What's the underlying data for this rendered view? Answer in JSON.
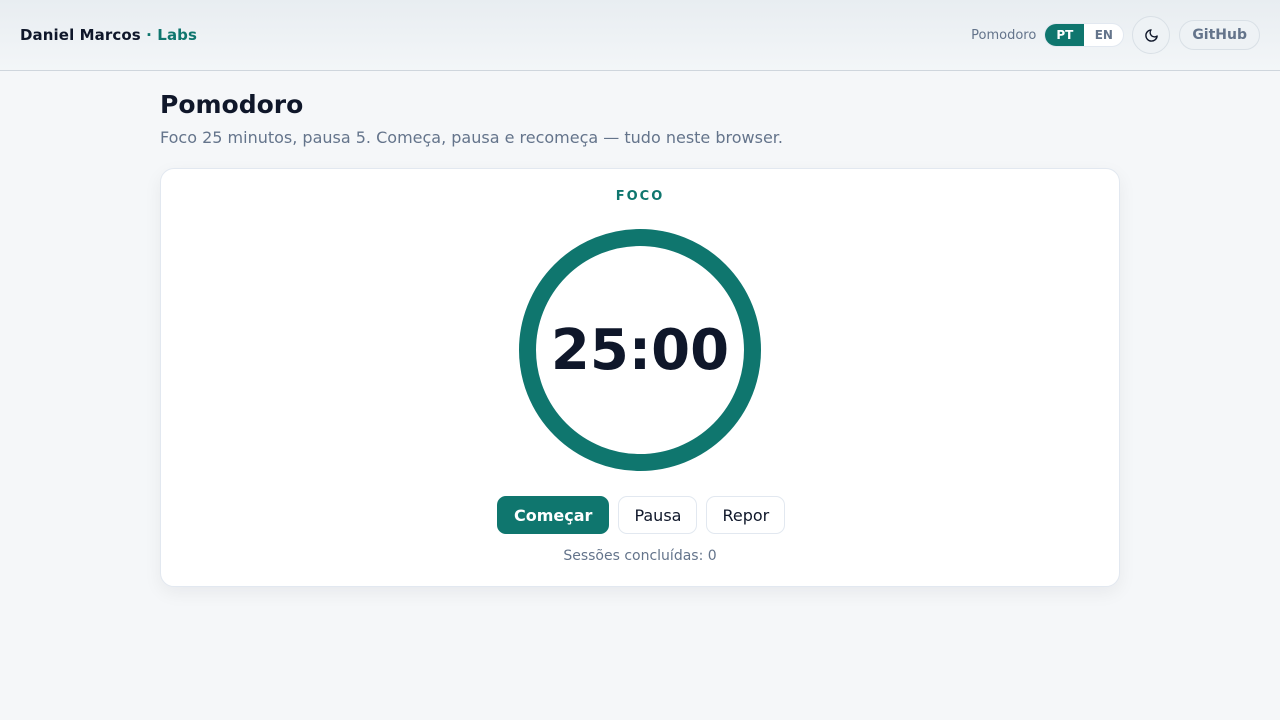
{
  "header": {
    "brand_name": "Daniel Marcos",
    "brand_separator": "·",
    "brand_labs": "Labs",
    "app_name": "Pomodoro",
    "languages": [
      "PT",
      "EN"
    ],
    "active_language": "PT",
    "github_label": "GitHub",
    "theme_icon": "moon-icon"
  },
  "page": {
    "title": "Pomodoro",
    "subtitle": "Foco 25 minutos, pausa 5. Começa, pausa e recomeça — tudo neste browser."
  },
  "timer": {
    "phase": "FOCO",
    "time": "25:00",
    "progress": 1.0,
    "ring_color": "#0f766e"
  },
  "controls": {
    "start_label": "Começar",
    "pause_label": "Pausa",
    "reset_label": "Repor"
  },
  "sessions": {
    "text": "Sessões concluídas: 0"
  },
  "colors": {
    "accent": "#0f766e",
    "text": "#0f172a",
    "muted": "#64748b"
  }
}
